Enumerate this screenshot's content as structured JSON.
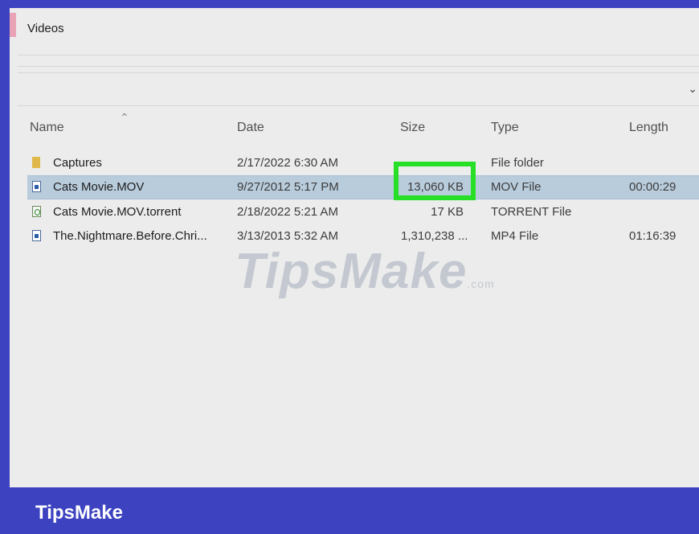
{
  "breadcrumb": "Videos",
  "columns": {
    "name": "Name",
    "date": "Date",
    "size": "Size",
    "type": "Type",
    "length": "Length"
  },
  "files": [
    {
      "name": "Captures",
      "date": "2/17/2022 6:30 AM",
      "size": "",
      "type": "File folder",
      "length": "",
      "icon": "folder-icon"
    },
    {
      "name": "Cats Movie.MOV",
      "date": "9/27/2012 5:17 PM",
      "size": "13,060 KB",
      "type": "MOV File",
      "length": "00:00:29",
      "icon": "video-file-icon",
      "selected": true
    },
    {
      "name": "Cats Movie.MOV.torrent",
      "date": "2/18/2022 5:21 AM",
      "size": "17 KB",
      "type": "TORRENT File",
      "length": "",
      "icon": "torrent-file-icon"
    },
    {
      "name": "The.Nightmare.Before.Chri...",
      "date": "3/13/2013 5:32 AM",
      "size": "1,310,238 ...",
      "type": "MP4 File",
      "length": "01:16:39",
      "icon": "video-file-icon"
    }
  ],
  "watermark": {
    "main": "TipsMake",
    "suffix": ".com"
  },
  "brand": "TipsMake",
  "colors": {
    "frame": "#3d43c0",
    "selection": "#b9ccdc",
    "highlight": "#27df27"
  },
  "icons": {
    "sort_caret": "caret-up-icon",
    "expand": "chevron-down-icon"
  }
}
